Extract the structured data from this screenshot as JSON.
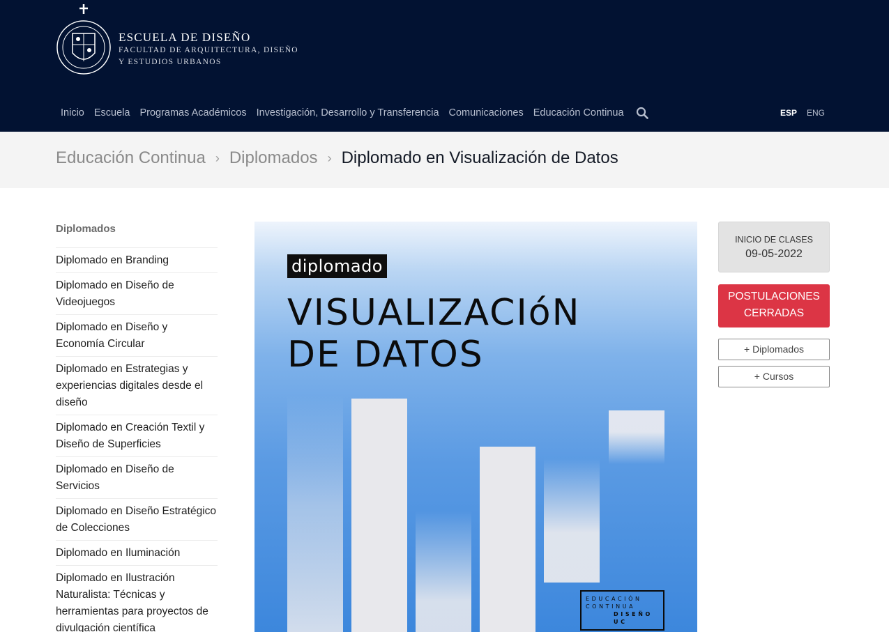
{
  "header": {
    "brand_title": "ESCUELA DE DISEÑO",
    "brand_sub_line1": "FACULTAD DE ARQUITECTURA, DISEÑO",
    "brand_sub_line2": "Y ESTUDIOS URBANOS",
    "seal_text": "PONTIFICIA UNIVERSIDAD CATÓLICA DE CHILE",
    "nav": [
      {
        "label": "Inicio"
      },
      {
        "label": "Escuela"
      },
      {
        "label": "Programas Académicos"
      },
      {
        "label": "Investigación, Desarrollo y Transferencia"
      },
      {
        "label": "Comunicaciones"
      },
      {
        "label": "Educación Continua"
      }
    ],
    "search_icon": "search-icon",
    "lang": {
      "esp": "ESP",
      "eng": "ENG"
    },
    "colors": {
      "bg": "#021232",
      "nav_text": "#b8bfcf"
    }
  },
  "breadcrumb": {
    "items": [
      "Educación Continua",
      "Diplomados"
    ],
    "current": "Diplomado en Visualización de Datos",
    "separator": "›"
  },
  "sidebar": {
    "title": "Diplomados",
    "items": [
      "Diplomado en Branding",
      "Diplomado en Diseño de Videojuegos",
      "Diplomado en Diseño y Economía Circular",
      "Diplomado en Estrategias y experiencias digitales desde el diseño",
      "Diplomado en Creación Textil y Diseño de Superficies",
      "Diplomado en Diseño de Servicios",
      "Diplomado en Diseño Estratégico de Colecciones",
      "Diplomado en Iluminación",
      "Diplomado en Ilustración Naturalista: Técnicas y herramientas para proyectos de divulgación científica"
    ]
  },
  "poster": {
    "badge": "diplomado",
    "title_line1": "VISUALIZACIóN",
    "title_line2": "DE DATOS",
    "stamp_lines": [
      "EDUCACIÓN",
      "CONTINUA",
      "DISEÑO",
      "UC"
    ]
  },
  "info": {
    "date_label": "INICIO DE CLASES",
    "date_value": "09-05-2022",
    "status_label": "POSTULACIONES CERRADAS",
    "status_color": "#dc3545",
    "more_diplomados": "+ Diplomados",
    "more_cursos": "+ Cursos"
  }
}
